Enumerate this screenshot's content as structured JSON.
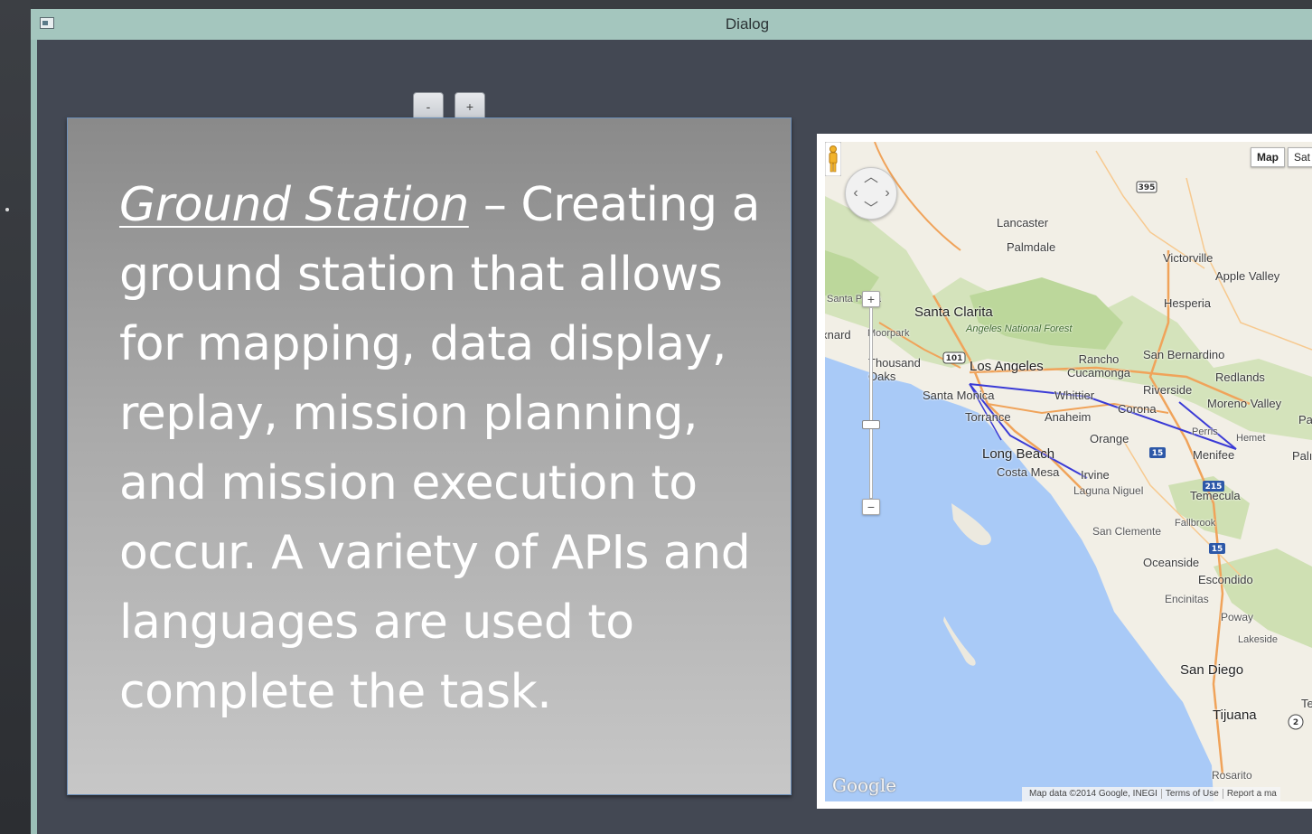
{
  "window": {
    "title": "Dialog"
  },
  "zoom_controls": {
    "minus_label": "-",
    "plus_label": "+"
  },
  "slide": {
    "heading": "Ground Station",
    "body": " – Creating a ground station that allows for mapping, data display, replay, mission planning, and mission execution to occur. A variety of APIs and languages are used to complete the task."
  },
  "map": {
    "type_buttons": [
      "Map",
      "Sat"
    ],
    "zoom_in_label": "+",
    "zoom_out_label": "−",
    "labels": {
      "lancaster": "Lancaster",
      "palmdale": "Palmdale",
      "victorville": "Victorville",
      "apple_valley": "Apple Valley",
      "hesperia": "Hesperia",
      "santa_paula": "Santa Paula",
      "santa_clarita": "Santa Clarita",
      "oxnard": "Oxnard",
      "moorpark": "Moorpark",
      "angeles_forest": "Angeles National Forest",
      "thousand_oaks": "Thousand Oaks",
      "los_angeles": "Los Angeles",
      "rancho_cucamonga": "Rancho Cucamonga",
      "san_bernardino": "San Bernardino",
      "redlands": "Redlands",
      "santa_monica": "Santa Monica",
      "whittier": "Whittier",
      "riverside": "Riverside",
      "moreno_valley": "Moreno Valley",
      "torrance": "Torrance",
      "anaheim": "Anaheim",
      "corona": "Corona",
      "perris": "Perris",
      "hemet": "Hemet",
      "orange": "Orange",
      "long_beach": "Long Beach",
      "menifee": "Menifee",
      "costa_mesa": "Costa Mesa",
      "irvine": "Irvine",
      "laguna_niguel": "Laguna Niguel",
      "temecula": "Temecula",
      "fallbrook": "Fallbrook",
      "san_clemente": "San Clemente",
      "oceanside": "Oceanside",
      "escondido": "Escondido",
      "encinitas": "Encinitas",
      "poway": "Poway",
      "lakeside": "Lakeside",
      "san_diego": "San Diego",
      "tijuana": "Tijuana",
      "rosarito": "Rosarito",
      "palm_1": "Pal",
      "palm_2": "Palı",
      "tecate": "Tec"
    },
    "shields": {
      "i395": "395",
      "us101": "101",
      "i15a": "15",
      "i15b": "15",
      "i215": "215",
      "r2": "2"
    },
    "attribution": [
      "Map data ©2014 Google, INEGI",
      "Terms of Use",
      "Report a ma"
    ],
    "logo": "Google"
  },
  "colors": {
    "titlebar": "#a4c6be",
    "client_bg": "#434853",
    "slide_text": "#ffffff",
    "route": "#3a3ad6"
  }
}
